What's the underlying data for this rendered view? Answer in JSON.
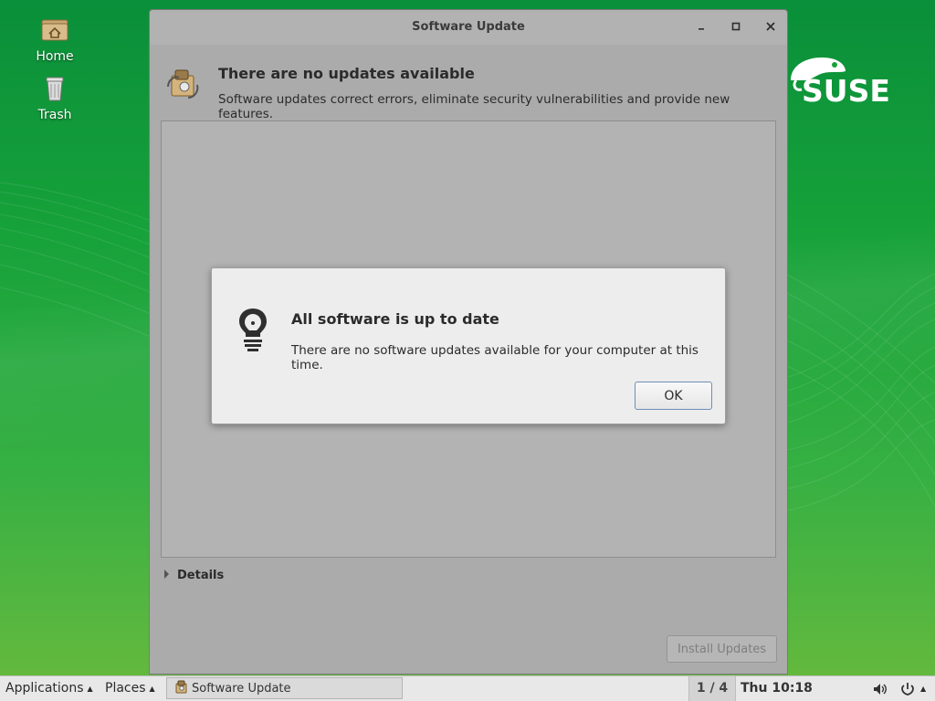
{
  "desktop": {
    "icons": [
      {
        "label": "Home",
        "icon": "home-folder-icon"
      },
      {
        "label": "Trash",
        "icon": "trash-icon"
      }
    ],
    "brand": {
      "text": "SUSE",
      "color": "#ffffff"
    }
  },
  "window": {
    "title": "Software Update",
    "buttons": {
      "minimize": "minimize-icon",
      "maximize": "maximize-icon",
      "close": "close-icon"
    },
    "header": {
      "title": "There are no updates available",
      "subtitle": "Software updates correct errors, eliminate security vulnerabilities and provide new features."
    },
    "details_label": "Details",
    "install_button": "Install Updates"
  },
  "dialog": {
    "title": "All software is up to date",
    "message": "There are no software updates available for your computer at this time.",
    "ok_label": "OK",
    "icon": "lightbulb-icon"
  },
  "taskbar": {
    "applications": "Applications",
    "places": "Places",
    "task_label": "Software Update",
    "workspace": "1 / 4",
    "clock": "Thu 10:18",
    "volume_icon": "volume-icon",
    "power_icon": "power-icon"
  },
  "colors": {
    "desktop_green": "#17a23a",
    "window_bg": "#ababab",
    "dialog_bg": "#ededed",
    "taskbar_bg": "#e8e8e8"
  }
}
